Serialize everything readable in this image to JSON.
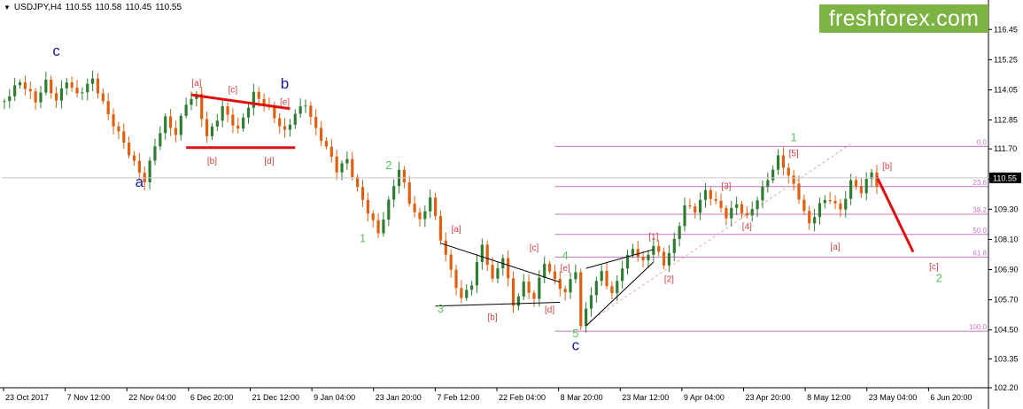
{
  "header": {
    "symbol": "USDJPY,H4",
    "open": "110.55",
    "high": "110.58",
    "low": "110.45",
    "close": "110.55"
  },
  "logo": {
    "text": "freshforex.com",
    "color": "#7cb342"
  },
  "chart_data": {
    "type": "candlestick",
    "ylim": [
      102.2,
      117.2
    ],
    "y_ticks": [
      "116.45",
      "115.25",
      "114.05",
      "112.85",
      "111.70",
      "110.50",
      "109.30",
      "108.10",
      "106.90",
      "105.70",
      "104.50",
      "103.35",
      "102.20"
    ],
    "x_ticks": [
      "23 Oct 2017",
      "7 Nov 12:00",
      "22 Nov 04:00",
      "6 Dec 20:00",
      "21 Dec 12:00",
      "9 Jan 04:00",
      "23 Jan 20:00",
      "7 Feb 12:00",
      "22 Feb 04:00",
      "8 Mar 20:00",
      "23 Mar 12:00",
      "9 Apr 04:00",
      "23 Apr 20:00",
      "8 May 12:00",
      "23 May 04:00",
      "6 Jun 20:00"
    ],
    "current_price": "110.55",
    "price_path": [
      [
        0,
        113.6
      ],
      [
        3,
        114.2
      ],
      [
        6,
        113.5
      ],
      [
        8,
        114.4
      ],
      [
        10,
        113.8
      ],
      [
        12,
        114.6
      ],
      [
        14,
        113.9
      ],
      [
        17,
        114.3
      ],
      [
        20,
        112.9
      ],
      [
        23,
        112.0
      ],
      [
        25,
        111.3
      ],
      [
        27,
        110.6
      ],
      [
        29,
        111.9
      ],
      [
        31,
        112.8
      ],
      [
        33,
        112.1
      ],
      [
        35,
        113.4
      ],
      [
        37,
        113.8
      ],
      [
        39,
        112.3
      ],
      [
        42,
        113.5
      ],
      [
        45,
        112.4
      ],
      [
        48,
        113.7
      ],
      [
        51,
        113.2
      ],
      [
        54,
        112.5
      ],
      [
        56,
        113.3
      ],
      [
        58,
        113.6
      ],
      [
        60,
        112.4
      ],
      [
        62,
        111.6
      ],
      [
        64,
        110.7
      ],
      [
        66,
        111.2
      ],
      [
        68,
        110.2
      ],
      [
        70,
        109.4
      ],
      [
        72,
        108.5
      ],
      [
        74,
        109.6
      ],
      [
        76,
        110.8
      ],
      [
        78,
        109.4
      ],
      [
        80,
        108.7
      ],
      [
        82,
        109.8
      ],
      [
        84,
        108.3
      ],
      [
        86,
        107.0
      ],
      [
        88,
        105.8
      ],
      [
        90,
        106.3
      ],
      [
        92,
        107.7
      ],
      [
        94,
        106.3
      ],
      [
        96,
        107.4
      ],
      [
        98,
        105.6
      ],
      [
        100,
        106.5
      ],
      [
        102,
        105.9
      ],
      [
        104,
        107.2
      ],
      [
        106,
        106.3
      ],
      [
        108,
        105.8
      ],
      [
        110,
        106.8
      ],
      [
        111,
        104.6
      ],
      [
        113,
        106.1
      ],
      [
        115,
        107.0
      ],
      [
        117,
        106.0
      ],
      [
        119,
        107.0
      ],
      [
        121,
        107.6
      ],
      [
        123,
        107.0
      ],
      [
        125,
        107.8
      ],
      [
        127,
        107.2
      ],
      [
        129,
        108.2
      ],
      [
        131,
        109.6
      ],
      [
        133,
        109.3
      ],
      [
        135,
        109.9
      ],
      [
        137,
        109.4
      ],
      [
        139,
        108.9
      ],
      [
        141,
        109.5
      ],
      [
        143,
        109.1
      ],
      [
        145,
        109.9
      ],
      [
        147,
        110.6
      ],
      [
        149,
        111.3
      ],
      [
        151,
        110.5
      ],
      [
        153,
        109.6
      ],
      [
        155,
        108.6
      ],
      [
        157,
        109.6
      ],
      [
        159,
        109.9
      ],
      [
        161,
        109.4
      ],
      [
        163,
        110.4
      ],
      [
        165,
        109.9
      ],
      [
        167,
        110.6
      ],
      [
        168,
        110.1
      ]
    ],
    "projection": [
      [
        168,
        110.6
      ],
      [
        175,
        107.6
      ]
    ],
    "triangles": [
      {
        "color": "#e01010",
        "lines": [
          [
            [
              36,
              113.85
            ],
            [
              55,
              113.3
            ]
          ],
          [
            [
              35,
              111.75
            ],
            [
              56,
              111.75
            ]
          ]
        ]
      },
      {
        "color": "#000000",
        "lines": [
          [
            [
              84,
              107.95
            ],
            [
              107,
              106.4
            ]
          ],
          [
            [
              83,
              105.45
            ],
            [
              107,
              105.6
            ]
          ]
        ]
      },
      {
        "color": "#000000",
        "lines": [
          [
            [
              112,
              106.95
            ],
            [
              125,
              107.7
            ]
          ],
          [
            [
              112,
              104.65
            ],
            [
              125,
              107.2
            ]
          ]
        ]
      }
    ],
    "fibonacci": {
      "x_start": 106,
      "x_end": 187,
      "levels": [
        {
          "label": "0.0",
          "price": 111.8
        },
        {
          "label": "23.6",
          "price": 110.2
        },
        {
          "label": "38.2",
          "price": 109.1
        },
        {
          "label": "50.0",
          "price": 108.3
        },
        {
          "label": "61.8",
          "price": 107.4
        },
        {
          "label": "100.0",
          "price": 104.45
        }
      ],
      "color": "#c873c8"
    },
    "trendline": {
      "from": [
        111,
        104.6
      ],
      "to": [
        163,
        111.9
      ],
      "color": "#e2a8a8"
    },
    "wave_labels": [
      {
        "text": "c",
        "x": 10,
        "p": 115.4,
        "size": "big",
        "color": "#1a1a9a"
      },
      {
        "text": "a",
        "x": 26,
        "p": 110.2,
        "size": "big",
        "color": "#1a1a9a"
      },
      {
        "text": "b",
        "x": 54,
        "p": 114.1,
        "size": "big",
        "color": "#1a1a9a"
      },
      {
        "text": "c",
        "x": 110,
        "p": 103.7,
        "size": "big",
        "color": "#1a1a9a"
      },
      {
        "text": "2",
        "x": 74,
        "p": 110.9,
        "size": "mid",
        "color": "#5cbf5c"
      },
      {
        "text": "1",
        "x": 69,
        "p": 108.0,
        "size": "mid",
        "color": "#5cbf5c"
      },
      {
        "text": "3",
        "x": 84,
        "p": 105.2,
        "size": "mid",
        "color": "#5cbf5c"
      },
      {
        "text": "4",
        "x": 108,
        "p": 107.3,
        "size": "mid",
        "color": "#5cbf5c"
      },
      {
        "text": "5",
        "x": 110,
        "p": 104.2,
        "size": "mid",
        "color": "#5cbf5c"
      },
      {
        "text": "1",
        "x": 152,
        "p": 112.0,
        "size": "mid",
        "color": "#5cbf5c"
      },
      {
        "text": "2",
        "x": 180,
        "p": 106.4,
        "size": "mid",
        "color": "#5cbf5c"
      },
      {
        "text": "[a]",
        "x": 37,
        "p": 114.2,
        "size": "small",
        "color": "#d04040"
      },
      {
        "text": "[c]",
        "x": 44,
        "p": 113.95,
        "size": "small",
        "color": "#d04040"
      },
      {
        "text": "[e]",
        "x": 54,
        "p": 113.45,
        "size": "small",
        "color": "#d04040"
      },
      {
        "text": "[b]",
        "x": 40,
        "p": 111.1,
        "size": "small",
        "color": "#d04040"
      },
      {
        "text": "[d]",
        "x": 51,
        "p": 111.1,
        "size": "small",
        "color": "#d04040"
      },
      {
        "text": "[a]",
        "x": 87,
        "p": 108.4,
        "size": "small",
        "color": "#d04040"
      },
      {
        "text": "[c]",
        "x": 102,
        "p": 107.65,
        "size": "small",
        "color": "#d04040"
      },
      {
        "text": "[e]",
        "x": 108,
        "p": 106.85,
        "size": "small",
        "color": "#d04040"
      },
      {
        "text": "[b]",
        "x": 94,
        "p": 104.9,
        "size": "small",
        "color": "#d04040"
      },
      {
        "text": "[d]",
        "x": 105,
        "p": 105.2,
        "size": "small",
        "color": "#d04040"
      },
      {
        "text": "[1]",
        "x": 125,
        "p": 108.1,
        "size": "small",
        "color": "#d04040"
      },
      {
        "text": "[2]",
        "x": 128,
        "p": 106.4,
        "size": "small",
        "color": "#d04040"
      },
      {
        "text": "[3]",
        "x": 139,
        "p": 110.1,
        "size": "small",
        "color": "#d04040"
      },
      {
        "text": "[4]",
        "x": 143,
        "p": 108.5,
        "size": "small",
        "color": "#d04040"
      },
      {
        "text": "[5]",
        "x": 152,
        "p": 111.4,
        "size": "small",
        "color": "#d04040"
      },
      {
        "text": "[a]",
        "x": 160,
        "p": 107.7,
        "size": "small",
        "color": "#d04040"
      },
      {
        "text": "[b]",
        "x": 170,
        "p": 110.9,
        "size": "small",
        "color": "#d04040"
      },
      {
        "text": "[c]",
        "x": 179,
        "p": 106.9,
        "size": "small",
        "color": "#d04040"
      }
    ],
    "colors": {
      "up": "#2e7d32",
      "down": "#e06010",
      "projection": "#e01010"
    }
  }
}
